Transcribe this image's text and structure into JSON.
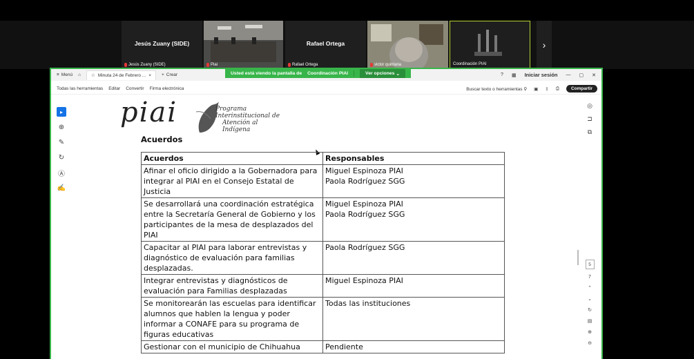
{
  "meeting": {
    "participants": [
      {
        "center_name": "Jesús Zuany (SIDE)",
        "footer": "Jesús Zuany (SIDE)",
        "muted": true
      },
      {
        "center_name": "",
        "footer": "Piai",
        "muted": true
      },
      {
        "center_name": "Rafael Ortega",
        "footer": "Rafael Ortega",
        "muted": true
      },
      {
        "center_name": "",
        "footer": "victor quintana",
        "muted": true
      },
      {
        "center_name": "",
        "footer": "Coordinación PIAI",
        "muted": false
      }
    ],
    "share_banner": {
      "text": "Usted está viendo la pantalla de",
      "presenter": "Coordinación PIAI",
      "options_label": "Ver opciones"
    }
  },
  "app": {
    "menu_label": "Menú",
    "tab_title": "Minuta 24 de Febrero ...",
    "new_tab_label": "Crear",
    "sign_in_label": "Iniciar sesión",
    "toolbar": {
      "all_tools": "Todas las herramientas",
      "edit": "Editar",
      "convert": "Convertir",
      "e_signature": "Firma electrónica",
      "search": "Buscar texto o herramientas",
      "share": "Compartir"
    },
    "page_nav": {
      "current_page": "5",
      "total_pages": "7"
    }
  },
  "document": {
    "logo_text": "piai",
    "logo_subtitle": [
      "Programa",
      "Interinstitucional de",
      "Atención al",
      "Indígena"
    ],
    "section_heading": "Acuerdos",
    "table": {
      "headers": [
        "Acuerdos",
        "Responsables"
      ],
      "rows": [
        {
          "acuerdo": "Afinar el oficio dirigido a la Gobernadora para integrar al PIAI en el Consejo Estatal de Justicia",
          "responsables": [
            "Miguel Espinoza PIAI",
            "Paola Rodríguez SGG"
          ]
        },
        {
          "acuerdo": "Se desarrollará una coordinación estratégica entre la Secretaría General de Gobierno y los participantes de la mesa de desplazados del PIAI",
          "responsables": [
            "Miguel Espinoza PIAI",
            "Paola Rodríguez SGG"
          ]
        },
        {
          "acuerdo": "Capacitar al PIAI para laborar entrevistas y diagnóstico de evaluación para familias desplazadas.",
          "responsables": [
            "Paola Rodríguez SGG"
          ]
        },
        {
          "acuerdo": "Integrar entrevistas y diagnósticos de evaluación para Familias desplazadas",
          "responsables": [
            "Miguel Espinoza PIAI"
          ]
        },
        {
          "acuerdo": "Se monitorearán las escuelas para identificar alumnos que hablen la lengua y poder informar a CONAFE para su programa de figuras educativas",
          "responsables": [
            "Todas las instituciones"
          ]
        },
        {
          "acuerdo": "Gestionar con el municipio de Chihuahua",
          "responsables": [
            "Pendiente"
          ]
        }
      ]
    }
  },
  "colors": {
    "share_green": "#38b54a",
    "highlight": "#b5d334",
    "tool_blue": "#1473e6"
  }
}
